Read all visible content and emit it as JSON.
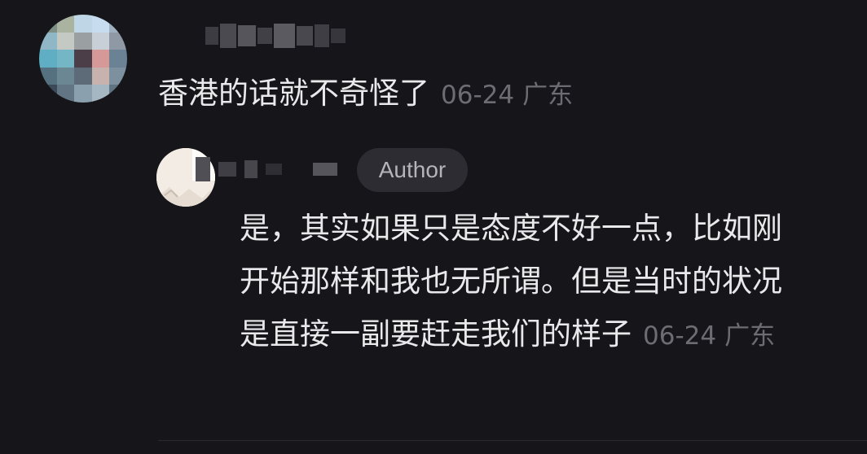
{
  "comment": {
    "text": "香港的话就不奇怪了",
    "date": "06-24",
    "location": "广东"
  },
  "reply": {
    "badge": "Author",
    "text": "是，其实如果只是态度不好一点，比如刚开始那样和我也无所谓。但是当时的状况是直接一副要赶走我们的样子",
    "date": "06-24",
    "location": "广东"
  },
  "colors": {
    "background": "#16161a",
    "text": "#e9e9ec",
    "meta": "#6c6c72",
    "badge_bg": "#2c2c32",
    "badge_text": "#b4b4ba"
  }
}
